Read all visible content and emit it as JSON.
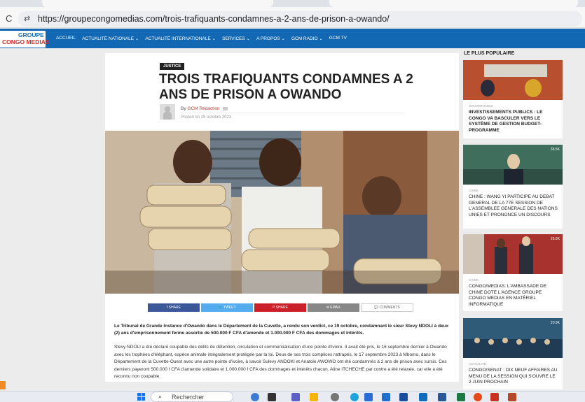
{
  "browser": {
    "reload_icon": "reload-icon",
    "url": "https://groupecongomedias.com/trois-trafiquants-condamnes-a-2-ans-de-prison-a-owando/"
  },
  "site": {
    "logo_top": "GROUPE",
    "logo_bottom": "CONGO MEDIAS",
    "menu": [
      "ACCUEIL",
      "ACTUALITÉ NATIONALE ⌄",
      "ACTUALITÉ INTERNATIONALE ⌄",
      "SERVICES ⌄",
      "A PROPOS ⌄",
      "GCM RADIO ⌄",
      "GCM TV"
    ],
    "nav_color": "#1268b3"
  },
  "article": {
    "category": "JUSTICE",
    "title": "TROIS TRAFIQUANTS CONDAMNES A 2 ANS DE PRISON A OWANDO",
    "by": "By",
    "author": "GCM Rédaction",
    "posted": "Posted on 25 octobre 2023",
    "share": {
      "facebook": "f  SHARE",
      "twitter": "🐦  TWEET",
      "pinterest": "P  SHARE",
      "email": "✉  EMAIL",
      "comments": "💬  COMMENTS"
    },
    "lead": "Le Tribunal de Grande Instance d'Owando dans le Département de la Cuvette, a rendu son verdict, ce 19 octobre, condamnant le sieur Stevy NDOLI à deux (2) ans d'emprisonnement ferme assortie de 500.000 F CFA d'amende et 1.000.000 F CFA des dommages et intérêts.",
    "body": "Stevy NDOLI a été déclaré coupable des délits de détention, circulation et commercialisation d'une pointe d'ivoire. Il avait été pris, le 16 septembre dernier à Owando avec les trophées d'éléphant, espèce animale intégralement protégée par la loi. Deux de ses trois complices rattrapés, le 17 septembre 2023 à Mbomo, dans le Département de la Cuvette-Ouest avec une autre pointe d'ivoire, à savoir Sulevy ANDOKI et Anatole AWOWO ont été condamnés à 2 ans de prison avec sursis. Ces derniers payeront 500.000 f CFA d'amende solidaire et 1.000.000 f CFA des dommages et intérêts chacun. Aline ITCHECHE par contre a été relaxée, car elle a été reconnu non coupable."
  },
  "sidebar": {
    "heading": "LE PLUS POPULAIRE",
    "cards": [
      {
        "category": "GOUVERNANCE",
        "title": "INVESTISSEMENTS PUBLICS : LE CONGO VA BASCULER VERS LE SYSTÈME DE GESTION BUDGET-PROGRAMME",
        "views": "",
        "bold": true
      },
      {
        "category": "CHINE",
        "title": "CHINE : WANG YI PARTICIPE AU DEBAT GENERAL DE LA 77E SESSION DE L'ASSEMBLEE GENERALE DES NATIONS UNIES ET PRONONCE UN DISCOURS",
        "views": "36.5K",
        "bold": false
      },
      {
        "category": "CHINE",
        "title": "CONGO/MEDIAS: L'AMBASSADE DE CHINE DOTE L'AGENCE GROUPE CONGO MEDIAS EN MATÉRIEL INFORMATIQUE",
        "views": "25.6K",
        "bold": false
      },
      {
        "category": "ACTUALITÉ",
        "title": "CONGO/SENAT : DIX NEUF AFFAIRES AU MENU DE LA SESSION QUI S'OUVRE LE 2 JUIN PROCHAIN",
        "views": "20.9K",
        "bold": false
      }
    ]
  },
  "taskbar": {
    "search_label": "Rechercher"
  }
}
